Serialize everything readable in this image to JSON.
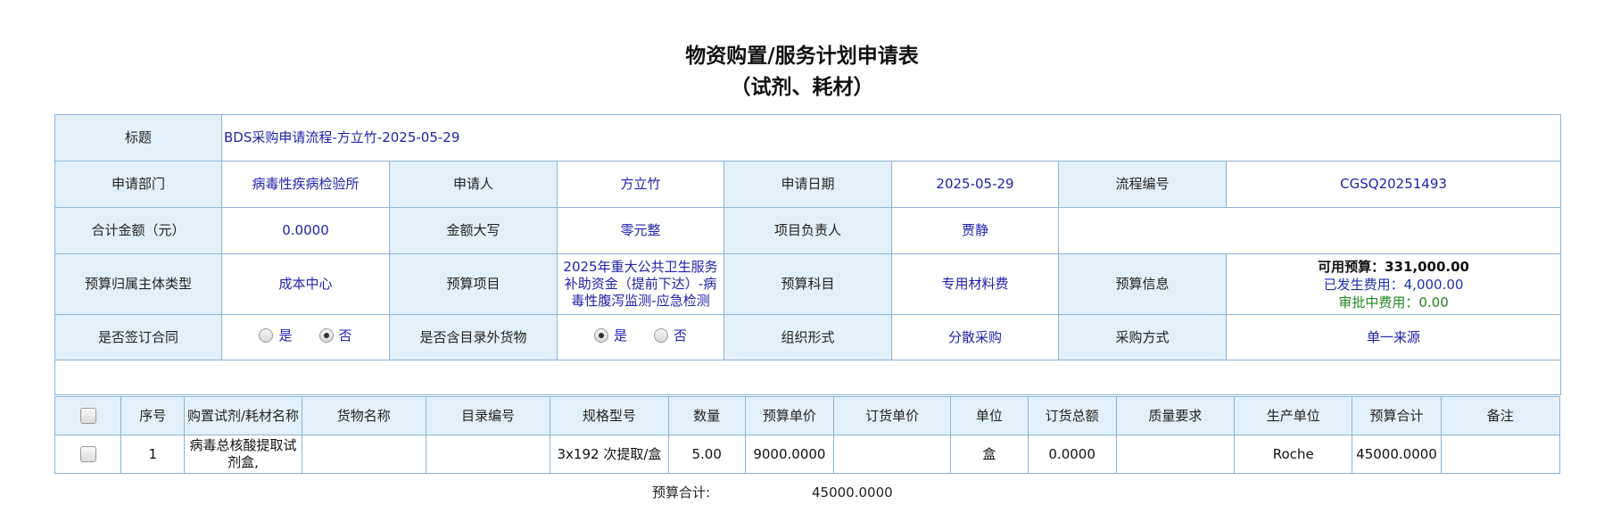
{
  "title": {
    "line1": "物资购置/服务计划申请表",
    "line2": "（试剂、耗材）"
  },
  "form": {
    "subject_label": "标题",
    "subject_value": "BDS采购申请流程-方立竹-2025-05-29",
    "dept_label": "申请部门",
    "dept_value": "病毒性疾病检验所",
    "applicant_label": "申请人",
    "applicant_value": "方立竹",
    "date_label": "申请日期",
    "date_value": "2025-05-29",
    "flow_label": "流程编号",
    "flow_value": "CGSQ20251493",
    "amount_label": "合计金额（元）",
    "amount_value": "0.0000",
    "amount_upper_label": "金额大写",
    "amount_upper_value": "零元整",
    "leader_label": "项目负责人",
    "leader_value": "贾静",
    "budget_type_label": "预算归属主体类型",
    "budget_type_value": "成本中心",
    "budget_item_label": "预算项目",
    "budget_item_value": "2025年重大公共卫生服务补助资金（提前下达）-病毒性腹泻监测-应急检测",
    "budget_subject_label": "预算科目",
    "budget_subject_value": "专用材料费",
    "budget_info_label": "预算信息",
    "budget_available": "可用预算：331,000.00",
    "budget_spent": "已发生费用：4,000.00",
    "budget_pending": "审批中费用：0.00",
    "contract_label": "是否签订合同",
    "contract_yes": "是",
    "contract_no": "否",
    "contract_selected": "否",
    "catalog_label": "是否含目录外货物",
    "catalog_yes": "是",
    "catalog_no": "否",
    "catalog_selected": "是",
    "org_label": "组织形式",
    "org_value": "分散采购",
    "method_label": "采购方式",
    "method_value": "单一来源"
  },
  "items": {
    "headers": [
      "序号",
      "购置试剂/耗材名称",
      "货物名称",
      "目录编号",
      "规格型号",
      "数量",
      "预算单价",
      "订货单价",
      "单位",
      "订货总额",
      "质量要求",
      "生产单位",
      "预算合计",
      "备注"
    ],
    "rows": [
      {
        "no": "1",
        "name": "病毒总核酸提取试剂盒,",
        "goods": "",
        "catalog_no": "",
        "spec": "3x192 次提取/盒",
        "qty": "5.00",
        "budget_price": "9000.0000",
        "order_price": "",
        "unit": "盒",
        "order_total": "0.0000",
        "quality": "",
        "maker": "Roche",
        "budget_total": "45000.0000",
        "remark": ""
      }
    ]
  },
  "footer": {
    "total_label": "预算合计:",
    "total_value": "45000.0000"
  }
}
